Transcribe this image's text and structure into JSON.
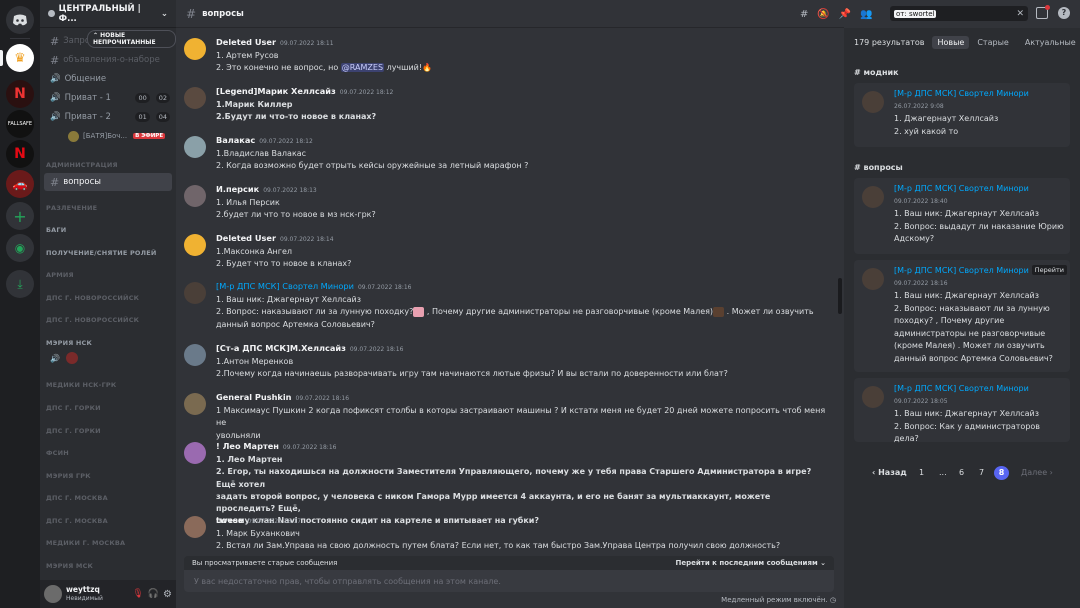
{
  "servers_rail": {
    "home": "discord-logo",
    "items": [
      "crown",
      "red-n",
      "fallsafe",
      "netflix",
      "car"
    ]
  },
  "server": {
    "name": "ЦЕНТРАЛЬНЫЙ | Ф...",
    "new_unread": "НОВЫЕ НЕПРОЧИТАННЫЕ"
  },
  "channels": [
    {
      "label": "Запросы-новостей",
      "dim": true
    },
    {
      "label": "объявления-о-наборе",
      "dim": true
    },
    {
      "label": "Общение",
      "voice": true
    },
    {
      "label": "Приват - 1",
      "voice": true,
      "b1": "00",
      "b2": "02"
    },
    {
      "label": "Приват - 2",
      "voice": true,
      "b1": "01",
      "b2": "04"
    }
  ],
  "voice_user": {
    "name": "[БАТЯ]Боч...",
    "live": "В ЭФИРЕ"
  },
  "categories": [
    "АДМИНИСТРАЦИЯ",
    "РАЗЛЕЧЕНИЕ",
    "БАГИ",
    "ПОЛУЧЕНИЕ/СНЯТИЕ РОЛЕЙ",
    "АРМИЯ",
    "ДПС Г. НОВОРОССИЙСК",
    "ДПС Г. НОВОРОССИЙСК",
    "МЭРИЯ НСК",
    "МЕДИКИ НСК-ГРК",
    "ДПС Г. ГОРКИ",
    "ДПС Г. ГОРКИ",
    "ФСИН",
    "МЭРИЯ ГРК",
    "ДПС Г. МОСКВА",
    "ДПС Г. МОСКВА",
    "МЕДИКИ Г. МОСКВА",
    "МЭРИЯ МСК"
  ],
  "selected_channel": "вопросы",
  "user": {
    "name": "weyttzq",
    "status": "Невидимый"
  },
  "topbar": {
    "channel": "вопросы",
    "search_value": "от: swortel"
  },
  "messages": [
    {
      "name": "Deleted User",
      "ts": "09.07.2022 18:11",
      "lines": [
        "1. Артем Русов"
      ],
      "mention_pre": "2. Это конечно не вопрос, но ",
      "mention": "@RAMZES",
      "mention_post": " лучший!"
    },
    {
      "name": "[Legend]Марик Хеллсайз",
      "ts": "09.07.2022 18:12",
      "lines": [
        "1.Марик Киллер",
        "2.Будут ли что-то новое в кланах?"
      ]
    },
    {
      "name": "Валакас",
      "ts": "09.07.2022 18:12",
      "lines": [
        "1.Владислав Валакас",
        "2. Когда возможно будет отрыть кейсы оружейные за летный марафон ?"
      ]
    },
    {
      "name": "И.персик",
      "ts": "09.07.2022 18:13",
      "lines": [
        "1. Илья Персик",
        "2.будет ли что то новое в мз нск-грк?"
      ]
    },
    {
      "name": "Deleted User",
      "ts": "09.07.2022 18:14",
      "lines": [
        "1.Максонка Ангел",
        "2. Будет что то новое в кланах?"
      ]
    },
    {
      "name": "[М-р ДПС МСК] Свортел Минори",
      "ts": "09.07.2022 18:16",
      "lines": [
        "1. Ваш ник: Джагернаут Хеллсайз",
        "2. Вопрос: наказывают ли за лунную походку?",
        "  , Почему другие администраторы не разговорчивые (кроме Малея)",
        "  . Может ли озвучить",
        "данный вопрос Артемка Соловьевич?"
      ]
    },
    {
      "name": "[Ст-а ДПС МСК]М.Хеллсайз",
      "ts": "09.07.2022 18:16",
      "lines": [
        "1.Антон Меренков",
        "2.Почему когда начинаешь разворачивать  игру там начинаются лютые фризы? И вы встали по доверенности или блат?"
      ]
    },
    {
      "name": "General Pushkin",
      "ts": "09.07.2022 18:16",
      "lines": [
        "1 Максимаус Пушкин 2 когда пофиксят столбы в которы застраивают машины ? И кстати меня не будет 20 дней можете попросить чтоб меня не",
        "увольняли"
      ]
    },
    {
      "name": "! Лео Мартен",
      "ts": "09.07.2022 18:16",
      "lines": [
        "1. Лео Мартен",
        "2. Егор, ты находишься на должности Заместителя Управляющего, почему же у тебя права Старшего Администратора в игре? Ещё хотел",
        "задать второй вопрос, у человека с ником Гамора Мурр имеется 4 аккаунта, и его не банят за мультиаккаунт, можете проследить? Ещё,",
        "почему клан Navi постоянно сидит на картеле и впитывает на губки?"
      ]
    },
    {
      "name": "twese",
      "ts": "09.07.2022 18:17",
      "lines": [
        "1. Марк Буханкович",
        "2. Встал ли Зам.Управа на свою должность путем блата? Если нет, то как там быстро Зам.Управа Центра получил свою должность?"
      ]
    }
  ],
  "old_bar": {
    "text": "Вы просматриваете старые сообщения",
    "jump": "Перейти к последним сообщениям"
  },
  "input_placeholder": "У вас недостаточно прав, чтобы отправлять сообщения на этом канале.",
  "slowmode": "Медленный режим включён.",
  "search": {
    "count": "179 результатов",
    "tabs": [
      "Новые",
      "Старые",
      "Актуальные"
    ],
    "sections": [
      {
        "channel": "модник",
        "results": [
          {
            "name": "[М-р ДПС МСК] Свортел Минори",
            "ts": "26.07.2022 9:08",
            "lines": [
              "1. Джагернаут Хеллсайз",
              "2. хуй какой то"
            ]
          }
        ]
      },
      {
        "channel": "вопросы",
        "results": [
          {
            "name": "[М-р ДПС МСК] Свортел Минори",
            "ts": "09.07.2022 18:40",
            "lines": [
              "1. Ваш ник: Джагернаут Хеллсайз",
              "2. Вопрос: выдадут ли наказание Юрию",
              "Адскому?"
            ]
          },
          {
            "name": "[М-р ДПС МСК] Свортел Минори",
            "ts": "09.07.2022 18:16",
            "lines": [
              "1. Ваш ник: Джагернаут Хеллсайз",
              "2. Вопрос: наказывают ли за лунную",
              "походку?  , Почему другие",
              "администраторы не разговорчивые",
              "(кроме Малея)  . Может ли озвучить",
              "данный вопрос Артемка Соловьевич?"
            ],
            "jump": "Перейти"
          },
          {
            "name": "[М-р ДПС МСК] Свортел Минори",
            "ts": "09.07.2022 18:05",
            "lines": [
              "1. Ваш ник: Джагернаут Хеллсайз",
              "2. Вопрос: Как у администраторов дела?"
            ]
          }
        ]
      }
    ],
    "pagination": {
      "back": "Назад",
      "pages": [
        "1",
        "...",
        "6",
        "7",
        "8"
      ],
      "current": "8",
      "next": "Далее"
    }
  },
  "colors": {
    "accent": "#5865f2",
    "link": "#00a8fc",
    "live": "#da373c"
  }
}
